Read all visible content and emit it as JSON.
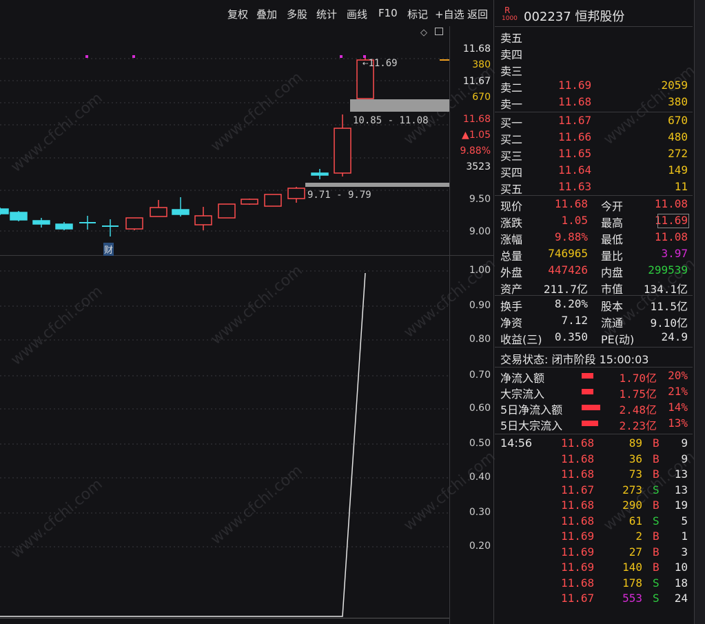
{
  "toolbar": {
    "items": [
      "复权",
      "叠加",
      "多股",
      "统计",
      "画线",
      "F10",
      "标记",
      "+自选",
      "返回"
    ]
  },
  "stock": {
    "badge_top": "R",
    "badge_bottom": "1000",
    "code_name": "002237 恒邦股份"
  },
  "kline": {
    "annotation_peak": "11.69",
    "range_upper": "10.85 - 11.08",
    "range_lower": "9.71 - 9.79",
    "marker_cai": "财",
    "axis_labels": [
      "11.68",
      "380",
      "11.67",
      "670",
      "11.68",
      "▲1.05",
      "9.88%",
      "3523",
      "9.50",
      "9.00"
    ]
  },
  "indicator": {
    "axis_labels": [
      "1.00",
      "0.90",
      "0.80",
      "0.70",
      "0.60",
      "0.50",
      "0.40",
      "0.30",
      "0.20"
    ]
  },
  "order_book": {
    "sell": [
      {
        "label": "卖五",
        "price": "",
        "vol": ""
      },
      {
        "label": "卖四",
        "price": "",
        "vol": ""
      },
      {
        "label": "卖三",
        "price": "",
        "vol": ""
      },
      {
        "label": "卖二",
        "price": "11.69",
        "vol": "2059"
      },
      {
        "label": "卖一",
        "price": "11.68",
        "vol": "380"
      }
    ],
    "buy": [
      {
        "label": "买一",
        "price": "11.67",
        "vol": "670"
      },
      {
        "label": "买二",
        "price": "11.66",
        "vol": "480"
      },
      {
        "label": "买三",
        "price": "11.65",
        "vol": "272"
      },
      {
        "label": "买四",
        "price": "11.64",
        "vol": "149"
      },
      {
        "label": "买五",
        "price": "11.63",
        "vol": "11"
      }
    ]
  },
  "stats": [
    {
      "l1": "现价",
      "v1": "11.68",
      "l2": "今开",
      "v2": "11.08"
    },
    {
      "l1": "涨跌",
      "v1": "1.05",
      "l2": "最高",
      "v2": "11.69"
    },
    {
      "l1": "涨幅",
      "v1": "9.88%",
      "l2": "最低",
      "v2": "11.08"
    },
    {
      "l1": "总量",
      "v1": "746965",
      "l2": "量比",
      "v2": "3.97"
    },
    {
      "l1": "外盘",
      "v1": "447426",
      "l2": "内盘",
      "v2": "299539"
    },
    {
      "l1": "资产",
      "v1": "211.7亿",
      "l2": "市值",
      "v2": "134.1亿"
    }
  ],
  "stats2": [
    {
      "l1": "换手",
      "v1": "8.20%",
      "l2": "股本",
      "v2": "11.5亿"
    },
    {
      "l1": "净资",
      "v1": "7.12",
      "l2": "流通",
      "v2": "9.10亿"
    },
    {
      "l1": "收益(三)",
      "v1": "0.350",
      "l2": "PE(动)",
      "v2": "24.9"
    }
  ],
  "status": "交易状态: 闭市阶段 15:00:03",
  "flows": [
    {
      "label": "净流入额",
      "amount": "1.70亿",
      "pct": "20%"
    },
    {
      "label": "大宗流入",
      "amount": "1.75亿",
      "pct": "21%"
    },
    {
      "label": "5日净流入额",
      "amount": "2.48亿",
      "pct": "14%"
    },
    {
      "label": "5日大宗流入",
      "amount": "2.23亿",
      "pct": "13%"
    }
  ],
  "ticks_time": "14:56",
  "ticks": [
    {
      "p": "11.68",
      "v": "89",
      "s": "B",
      "n": "9"
    },
    {
      "p": "11.68",
      "v": "36",
      "s": "B",
      "n": "9"
    },
    {
      "p": "11.68",
      "v": "73",
      "s": "B",
      "n": "13"
    },
    {
      "p": "11.67",
      "v": "273",
      "s": "S",
      "n": "13"
    },
    {
      "p": "11.68",
      "v": "290",
      "s": "B",
      "n": "19"
    },
    {
      "p": "11.68",
      "v": "61",
      "s": "S",
      "n": "5"
    },
    {
      "p": "11.69",
      "v": "2",
      "s": "B",
      "n": "1"
    },
    {
      "p": "11.69",
      "v": "27",
      "s": "B",
      "n": "3"
    },
    {
      "p": "11.69",
      "v": "140",
      "s": "B",
      "n": "10"
    },
    {
      "p": "11.68",
      "v": "178",
      "s": "S",
      "n": "18"
    },
    {
      "p": "11.67",
      "v": "553",
      "s": "S",
      "n": "24"
    }
  ],
  "watermark": "www.cfchi.com",
  "colors": {
    "up": "#ff4d4f",
    "down": "#3fd9e6",
    "bg": "#131316",
    "grid": "#3a3a3e"
  }
}
